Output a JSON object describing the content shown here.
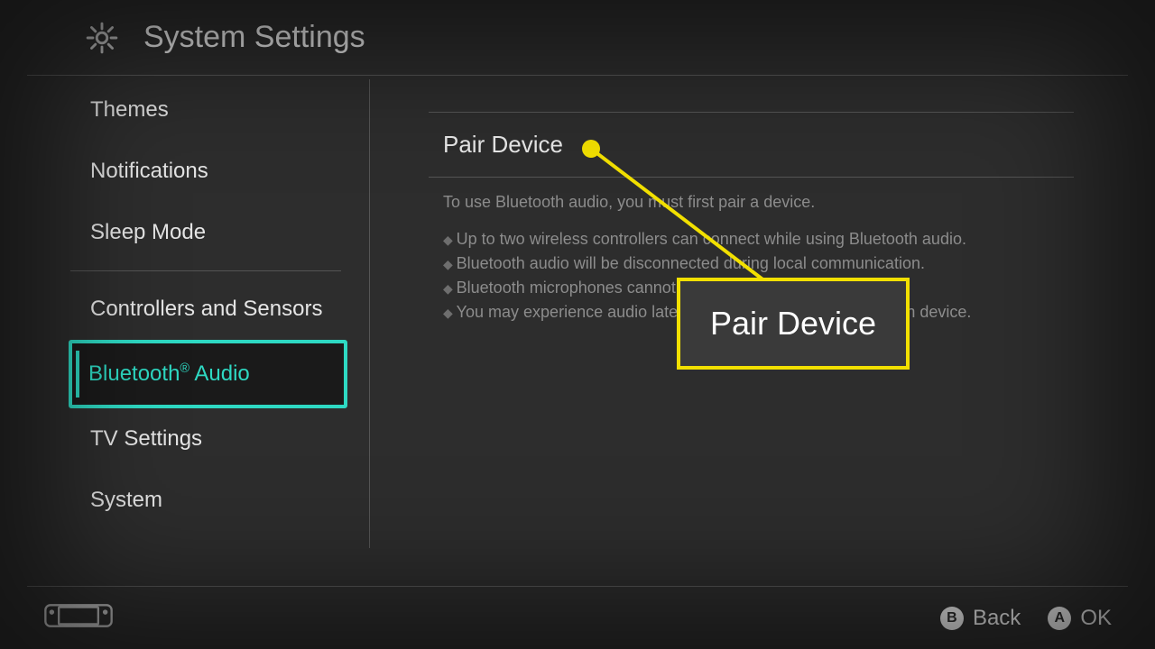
{
  "header": {
    "title": "System Settings"
  },
  "sidebar": {
    "items": [
      {
        "label": "Themes"
      },
      {
        "label": "Notifications"
      },
      {
        "label": "Sleep Mode"
      },
      {
        "label": "Controllers and Sensors"
      },
      {
        "label_html": "Bluetooth® Audio",
        "selected": true
      },
      {
        "label": "TV Settings"
      },
      {
        "label": "System"
      }
    ]
  },
  "content": {
    "pair_label": "Pair Device",
    "desc": "To use Bluetooth audio, you must first pair a device.",
    "bullets": [
      "Up to two wireless controllers can connect while using Bluetooth audio.",
      "Bluetooth audio will be disconnected during local communication.",
      "Bluetooth microphones cannot be used.",
      "You may experience audio latency depending on your Bluetooth device."
    ]
  },
  "callout": {
    "label": "Pair Device"
  },
  "footer": {
    "back": {
      "key": "B",
      "label": "Back"
    },
    "ok": {
      "key": "A",
      "label": "OK"
    }
  }
}
